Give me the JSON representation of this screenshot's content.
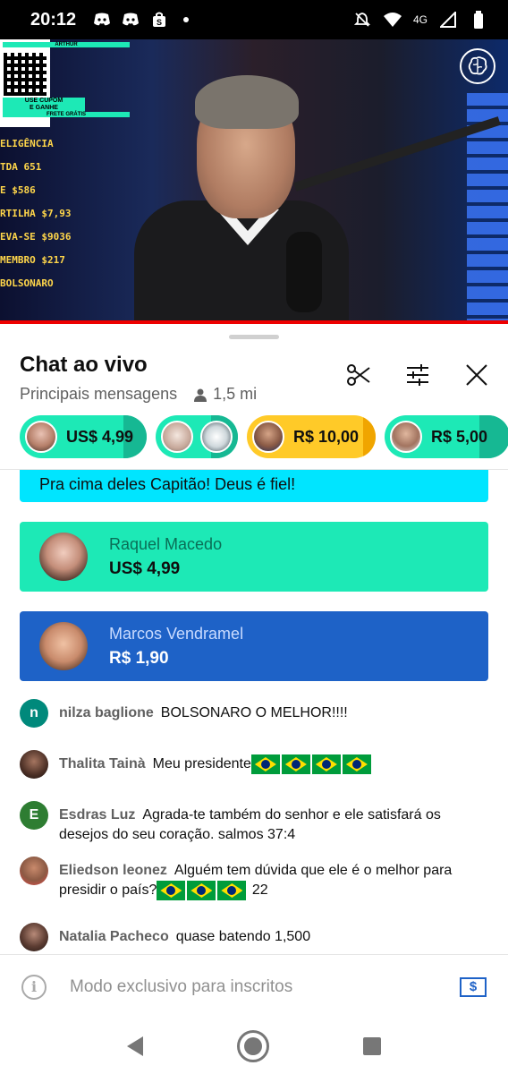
{
  "status_bar": {
    "time": "20:12",
    "network": "4G",
    "icons": [
      "discord-icon",
      "discord-icon",
      "shopping-bag-icon",
      "notification-dot",
      "mute-icon",
      "wifi-icon",
      "signal-icon",
      "battery-icon"
    ]
  },
  "video": {
    "qr_brand": "ARTHUR",
    "qr_text_1": "USE CUPOM",
    "qr_text_2": "E GANHE",
    "qr_text_3": "FRETE GRÁTIS",
    "goal_lines": [
      "ELIGÊNCIA",
      "TDA 651",
      "E      $586",
      "RTILHA $7,93",
      "EVA-SE $9036",
      "MEMBRO $217",
      "BOLSONARO"
    ],
    "progress_color": "#ee0000"
  },
  "chat": {
    "title": "Chat ao vivo",
    "mode": "Principais mensagens",
    "viewers": "1,5 mi",
    "icons": [
      "scissors-icon",
      "filter-icon",
      "close-icon"
    ],
    "tickers": [
      {
        "amount": "US$ 4,99",
        "color": "#1de9b6"
      },
      {
        "amount": "",
        "color": "#1de9b6"
      },
      {
        "amount": "R$ 10,00",
        "color": "#ffca28"
      },
      {
        "amount": "R$ 5,00",
        "color": "#1de9b6"
      }
    ],
    "pinned_message": "Pra cima deles Capitão! Deus é fiel!",
    "superchats": [
      {
        "name": "Raquel Macedo",
        "amount": "US$ 4,99",
        "color": "#1de9b6"
      },
      {
        "name": "Marcos Vendramel",
        "amount": "R$ 1,90",
        "color": "#1e62c7"
      }
    ],
    "messages": [
      {
        "author": "nilza baglione",
        "initial": "n",
        "text": "BOLSONARO O MELHOR!!!!",
        "flags": 0,
        "suffix": ""
      },
      {
        "author": "Thalita Tainà",
        "initial": "",
        "text": "Meu presidente",
        "flags": 4,
        "suffix": ""
      },
      {
        "author": "Esdras Luz",
        "initial": "E",
        "text": "Agrada-te também do senhor e ele satisfará os desejos do seu coração. salmos 37:4",
        "flags": 0,
        "suffix": ""
      },
      {
        "author": "Eliedson leonez",
        "initial": "",
        "text": "Alguém tem dúvida que ele é o melhor para presidir o país?",
        "flags": 3,
        "suffix": " 22"
      },
      {
        "author": "Natalia Pacheco",
        "initial": "",
        "text": "quase batendo 1,500",
        "flags": 0,
        "suffix": ""
      }
    ]
  },
  "input": {
    "placeholder": "Modo exclusivo para inscritos"
  }
}
